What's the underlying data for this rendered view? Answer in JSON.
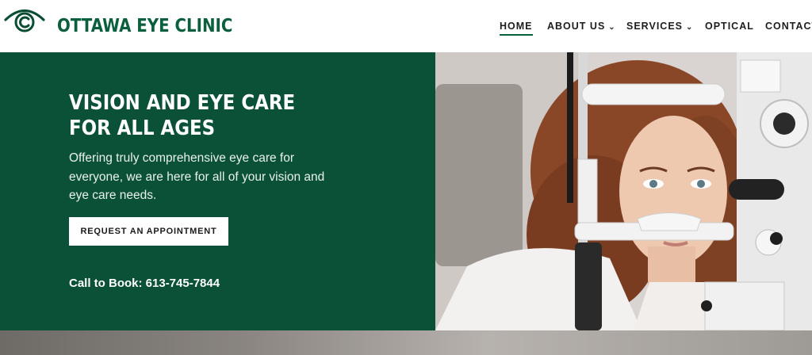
{
  "brand": {
    "name": "OTTAWA EYE CLINIC",
    "logo_icon": "eye-copyright-logo-icon",
    "color": "#0b5f3c"
  },
  "nav": {
    "items": [
      {
        "label": "HOME",
        "active": true
      },
      {
        "label": "ABOUT US",
        "dropdown": true
      },
      {
        "label": "SERVICES",
        "dropdown": true
      },
      {
        "label": "OPTICAL"
      },
      {
        "label": "CONTACT"
      }
    ],
    "chevron": "⌄"
  },
  "hero": {
    "title": "VISION AND EYE CARE FOR ALL AGES",
    "text": "Offering truly comprehensive eye care for everyone, we are here for all of your vision and eye care needs.",
    "cta_label": "REQUEST AN APPOINTMENT",
    "phone": "Call to Book: 613-745-7844",
    "panel_color": "#0b5137",
    "image": "woman-at-slit-lamp-eye-exam-photo"
  }
}
